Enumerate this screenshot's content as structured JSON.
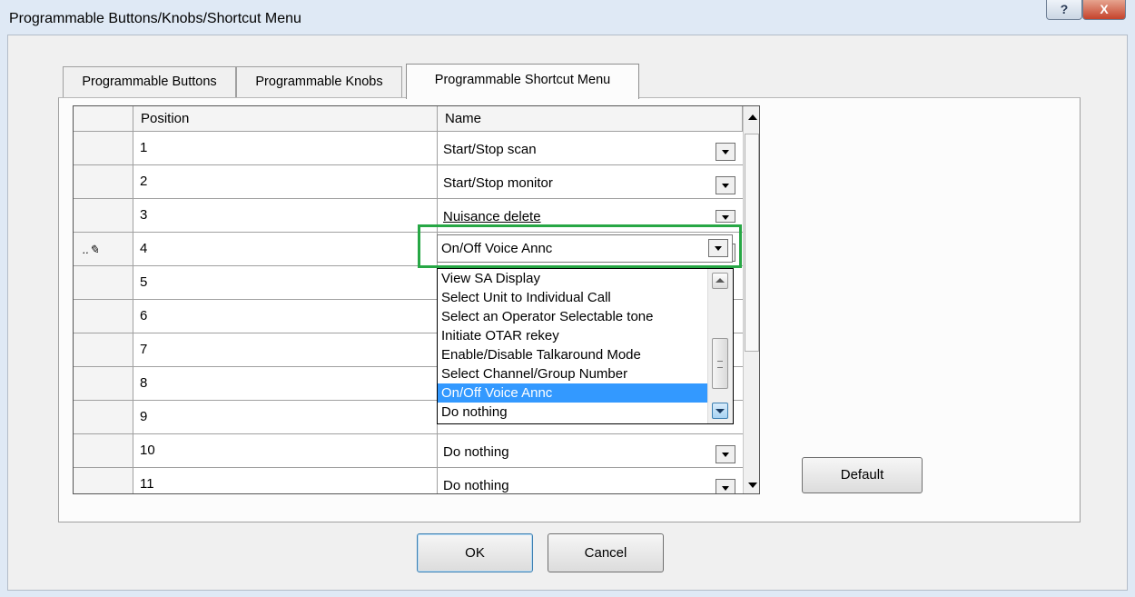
{
  "window": {
    "title": "Programmable Buttons/Knobs/Shortcut Menu",
    "help_glyph": "?",
    "close_glyph": "X"
  },
  "tabs": [
    {
      "label": "Programmable Buttons",
      "active": false
    },
    {
      "label": "Programmable Knobs",
      "active": false
    },
    {
      "label": "Programmable Shortcut Menu",
      "active": true
    }
  ],
  "grid": {
    "columns": [
      "Position",
      "Name"
    ],
    "editing_row_marker": "..✎",
    "rows": [
      {
        "position": "1",
        "name": "Start/Stop scan"
      },
      {
        "position": "2",
        "name": "Start/Stop monitor"
      },
      {
        "position": "3",
        "name": "Nuisance delete"
      },
      {
        "position": "4",
        "name": "On/Off Voice Annc"
      },
      {
        "position": "5",
        "name": ""
      },
      {
        "position": "6",
        "name": ""
      },
      {
        "position": "7",
        "name": ""
      },
      {
        "position": "8",
        "name": ""
      },
      {
        "position": "9",
        "name": ""
      },
      {
        "position": "10",
        "name": "Do nothing"
      },
      {
        "position": "11",
        "name": "Do nothing"
      }
    ]
  },
  "active_combo": {
    "value": "On/Off Voice Annc"
  },
  "dropdown": {
    "options": [
      "View SA Display",
      "Select Unit to Individual Call",
      "Select an Operator Selectable tone",
      "Initiate OTAR rekey",
      "Enable/Disable Talkaround Mode",
      "Select Channel/Group Number",
      "On/Off Voice Annc",
      "Do nothing"
    ],
    "selected": "On/Off Voice Annc"
  },
  "buttons": {
    "default": "Default",
    "ok": "OK",
    "cancel": "Cancel"
  },
  "colors": {
    "highlight_box": "#27a745",
    "selection": "#3399ff"
  }
}
